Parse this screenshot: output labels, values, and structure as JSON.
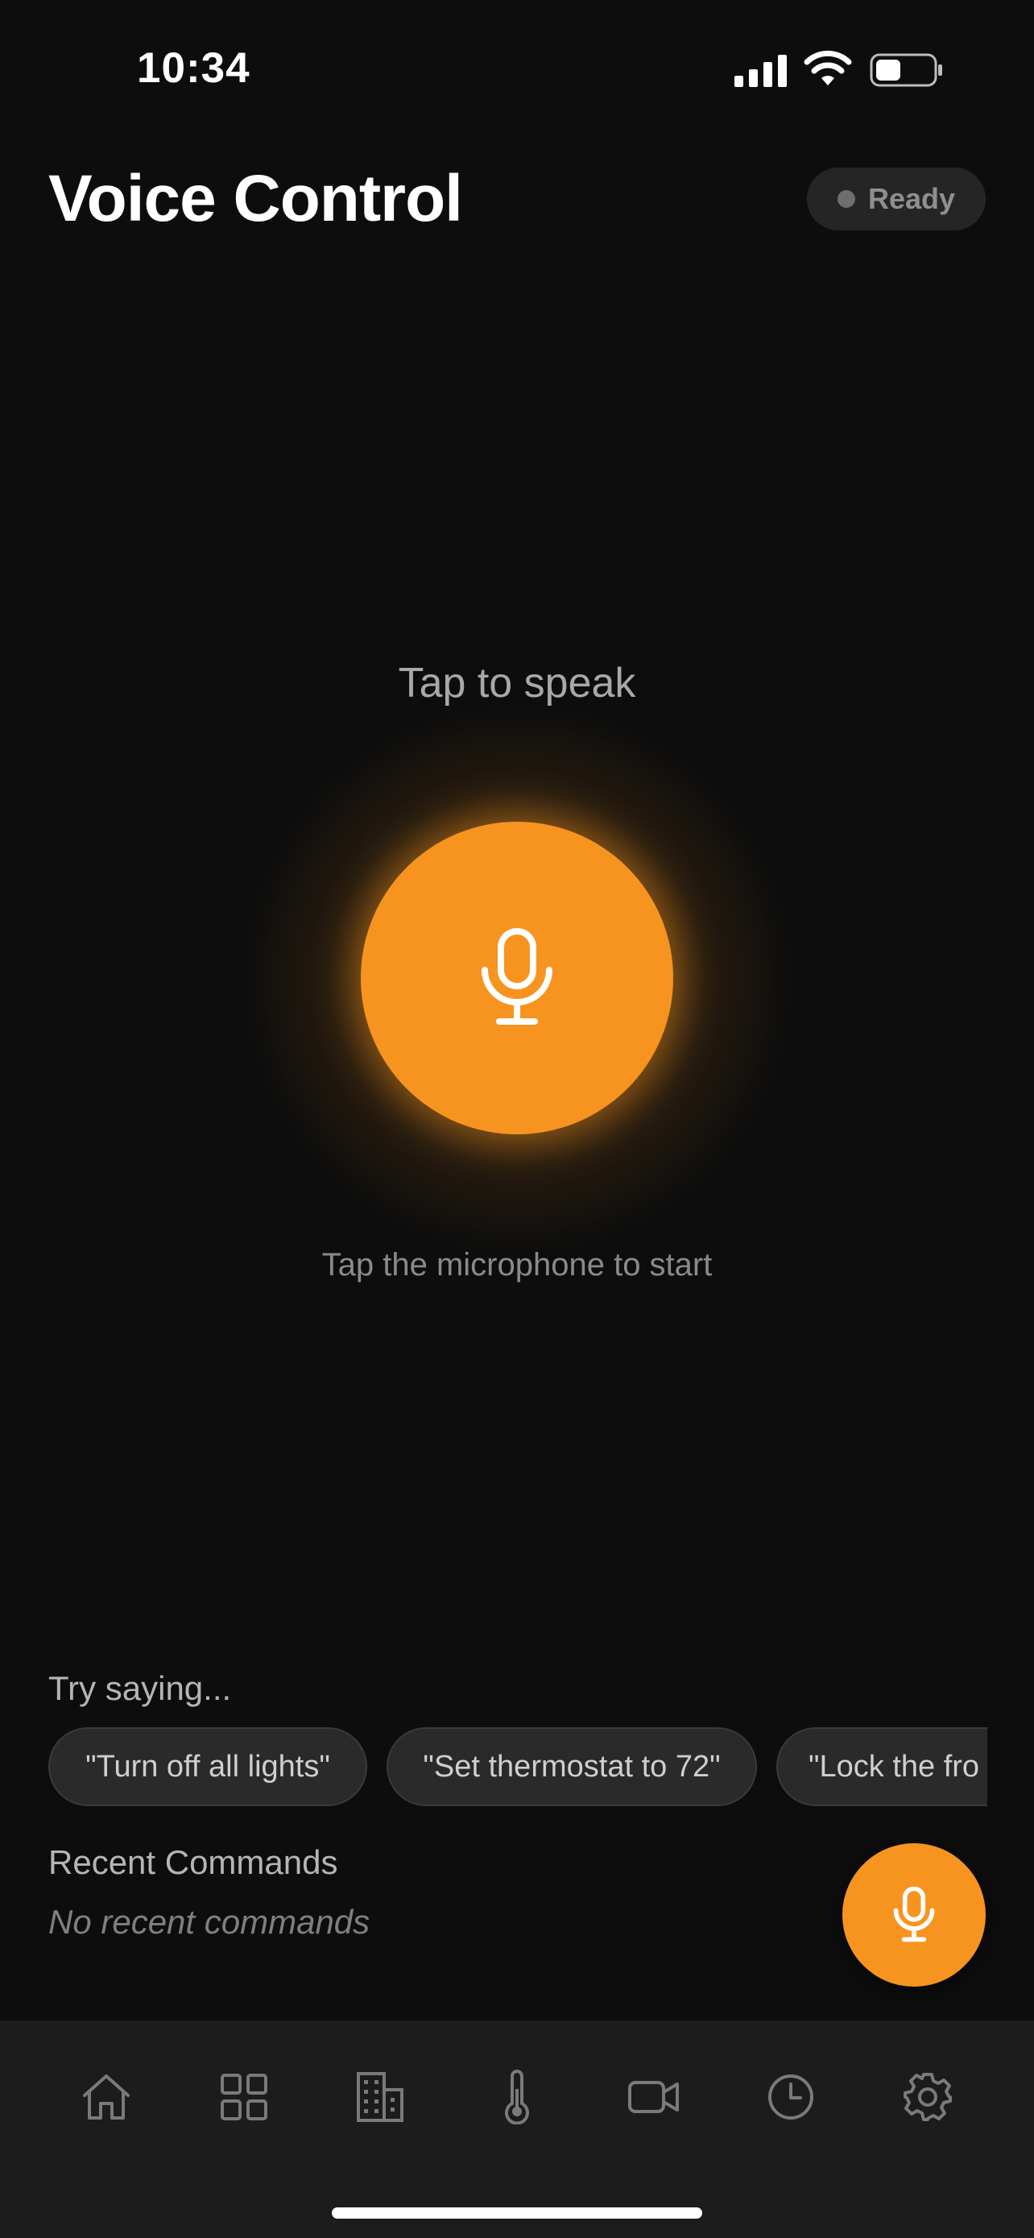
{
  "status_bar": {
    "time": "10:34"
  },
  "header": {
    "title": "Voice Control",
    "status": "Ready"
  },
  "voice": {
    "heading": "Tap to speak",
    "hint": "Tap the microphone to start"
  },
  "suggestions": {
    "label": "Try saying...",
    "items": [
      "\"Turn off all lights\"",
      "\"Set thermostat to 72\"",
      "\"Lock the fro"
    ]
  },
  "recent": {
    "title": "Recent Commands",
    "empty": "No recent commands"
  },
  "tabs": [
    "home-icon",
    "grid-icon",
    "building-icon",
    "thermometer-icon",
    "camera-icon",
    "clock-icon",
    "gear-icon"
  ],
  "colors": {
    "accent": "#f79420",
    "background": "#0d0d0d",
    "tab_bar": "#1c1c1c",
    "chip": "#2a2a2a"
  }
}
